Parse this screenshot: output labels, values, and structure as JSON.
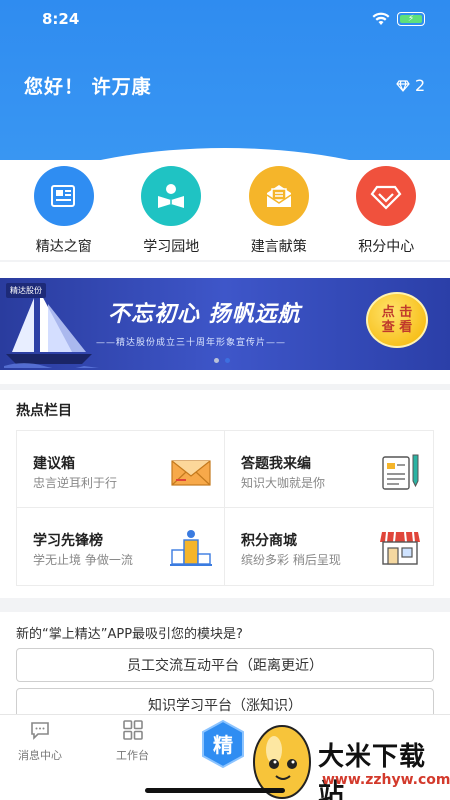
{
  "status_bar": {
    "time": "8:24"
  },
  "header": {
    "greeting": "您好！ 许万康",
    "points": "2"
  },
  "nav": [
    {
      "label": "精达之窗",
      "color": "#2f8df2",
      "icon": "newspaper-icon"
    },
    {
      "label": "学习园地",
      "color": "#1fc3c3",
      "icon": "reading-icon"
    },
    {
      "label": "建言献策",
      "color": "#f5b52a",
      "icon": "envelope-icon"
    },
    {
      "label": "积分中心",
      "color": "#f0513d",
      "icon": "diamond-icon"
    }
  ],
  "banner": {
    "logo": "精达股份",
    "title": "不忘初心  扬帆远航",
    "subtitle": "——精达股份成立三十周年形象宣传片——",
    "button_line1": "点 击",
    "button_line2": "查 看"
  },
  "hot": {
    "title": "热点栏目",
    "items": [
      {
        "name": "建议箱",
        "desc": "忠言逆耳利于行",
        "icon": "mail-icon"
      },
      {
        "name": "答题我来编",
        "desc": "知识大咖就是你",
        "icon": "notepad-icon"
      },
      {
        "name": "学习先锋榜",
        "desc": "学无止境 争做一流",
        "icon": "podium-icon"
      },
      {
        "name": "积分商城",
        "desc": "缤纷多彩 稍后呈现",
        "icon": "shop-icon"
      }
    ]
  },
  "survey": {
    "question": "新的“掌上精达”APP最吸引您的模块是?",
    "options": [
      "员工交流互动平台（距离更近）",
      "知识学习平台（涨知识）"
    ]
  },
  "tabbar": {
    "tabs": [
      {
        "label": "消息中心",
        "icon": "chat-icon"
      },
      {
        "label": "工作台",
        "icon": "grid-icon"
      }
    ],
    "center_label": "精"
  },
  "watermark": {
    "text": "大米下载站",
    "url": "www.zzhyw.com"
  }
}
